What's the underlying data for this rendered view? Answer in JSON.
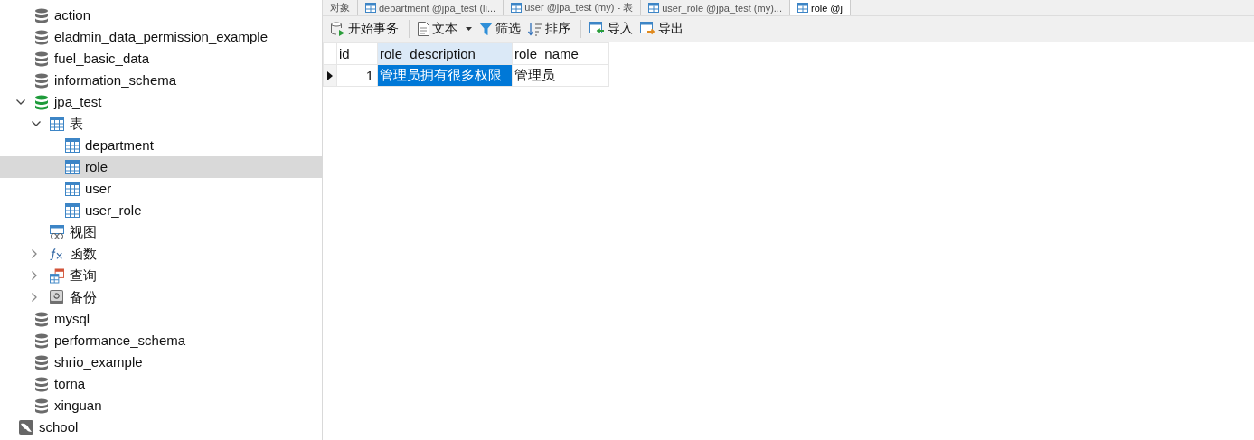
{
  "tree": [
    {
      "label": "action",
      "kind": "database",
      "selected": false
    },
    {
      "label": "eladmin_data_permission_example",
      "kind": "database",
      "selected": false
    },
    {
      "label": "fuel_basic_data",
      "kind": "database",
      "selected": false
    },
    {
      "label": "information_schema",
      "kind": "database",
      "selected": false
    },
    {
      "label": "jpa_test",
      "kind": "database-open",
      "selected": false,
      "expanded": true,
      "children": [
        {
          "label": "表",
          "kind": "tables",
          "selected": false,
          "expanded": true,
          "children": [
            {
              "label": "department",
              "kind": "table",
              "selected": false
            },
            {
              "label": "role",
              "kind": "table",
              "selected": true
            },
            {
              "label": "user",
              "kind": "table",
              "selected": false
            },
            {
              "label": "user_role",
              "kind": "table",
              "selected": false
            }
          ]
        },
        {
          "label": "视图",
          "kind": "views",
          "selected": false
        },
        {
          "label": "函数",
          "kind": "functions",
          "selected": false,
          "expanded": false
        },
        {
          "label": "查询",
          "kind": "queries",
          "selected": false,
          "expanded": false
        },
        {
          "label": "备份",
          "kind": "backups",
          "selected": false,
          "expanded": false
        }
      ]
    },
    {
      "label": "mysql",
      "kind": "database",
      "selected": false
    },
    {
      "label": "performance_schema",
      "kind": "database",
      "selected": false
    },
    {
      "label": "shrio_example",
      "kind": "database",
      "selected": false
    },
    {
      "label": "torna",
      "kind": "database",
      "selected": false
    },
    {
      "label": "xinguan",
      "kind": "database",
      "selected": false
    },
    {
      "label": "school",
      "kind": "connection",
      "selected": false
    }
  ],
  "tabs": [
    {
      "label": "对象",
      "kind": "objects",
      "selected": false
    },
    {
      "label": "department @jpa_test (li...",
      "kind": "table",
      "selected": false
    },
    {
      "label": "user @jpa_test (my) - 表",
      "kind": "table",
      "selected": false
    },
    {
      "label": "user_role @jpa_test (my)...",
      "kind": "table",
      "selected": false
    },
    {
      "label": "role @j",
      "kind": "table",
      "selected": true
    }
  ],
  "toolbar": [
    {
      "label": "开始事务",
      "kind": "transaction",
      "dropdown": false
    },
    {
      "label": "文本",
      "kind": "text",
      "dropdown": true
    },
    {
      "label": "筛选",
      "kind": "filter",
      "dropdown": false
    },
    {
      "label": "排序",
      "kind": "sort",
      "dropdown": false
    },
    {
      "label": "导入",
      "kind": "import",
      "dropdown": false
    },
    {
      "label": "导出",
      "kind": "export",
      "dropdown": false
    }
  ],
  "grid": {
    "columns": [
      {
        "label": "id",
        "selected": false
      },
      {
        "label": "role_description",
        "selected": true
      },
      {
        "label": "role_name",
        "selected": false
      }
    ],
    "rows": [
      {
        "current": true,
        "cells": [
          {
            "text": "1",
            "kind": "number",
            "selected": false
          },
          {
            "text": "管理员拥有很多权限",
            "kind": "text",
            "selected": true
          },
          {
            "text": "管理员",
            "kind": "text",
            "selected": false
          }
        ]
      }
    ]
  }
}
